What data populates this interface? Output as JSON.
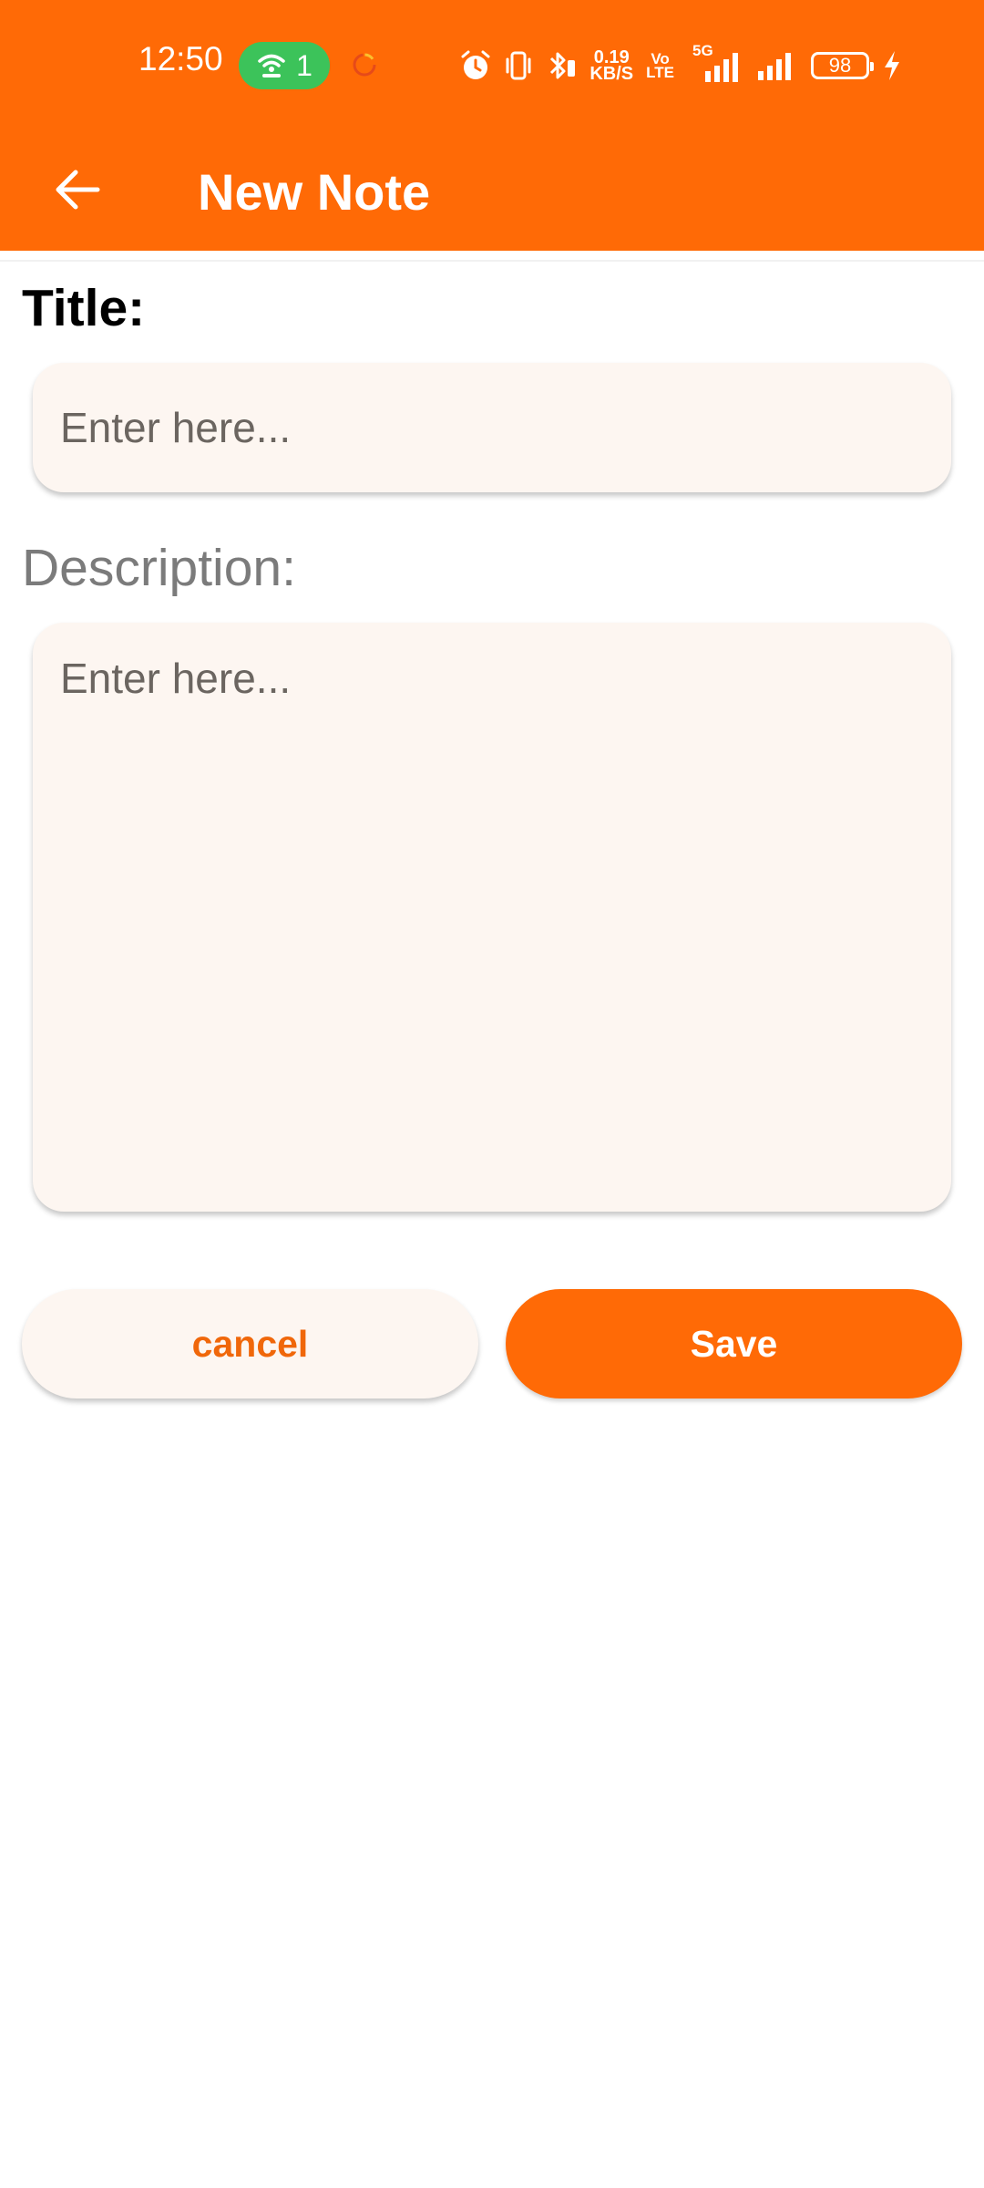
{
  "status_bar": {
    "time": "12:50",
    "hotspot_count": "1",
    "net_speed_value": "0.19",
    "net_speed_unit": "KB/S",
    "volte_top": "Vo",
    "volte_bottom": "LTE",
    "network_type": "5G",
    "battery": "98",
    "icons": [
      "hotspot-icon",
      "loading-icon",
      "alarm-icon",
      "vibrate-icon",
      "bluetooth-icon",
      "signal-icon",
      "charging-icon"
    ]
  },
  "app_bar": {
    "back_icon": "arrow-left-icon",
    "title": "New Note"
  },
  "form": {
    "title_label": "Title:",
    "title_placeholder": "Enter here...",
    "title_value": "",
    "description_label": "Description:",
    "description_placeholder": "Enter here...",
    "description_value": ""
  },
  "actions": {
    "cancel_label": "cancel",
    "save_label": "Save"
  },
  "colors": {
    "accent": "#ff6a06",
    "field_background": "#fdf6f1",
    "hotspot_badge": "#3cc35a"
  }
}
